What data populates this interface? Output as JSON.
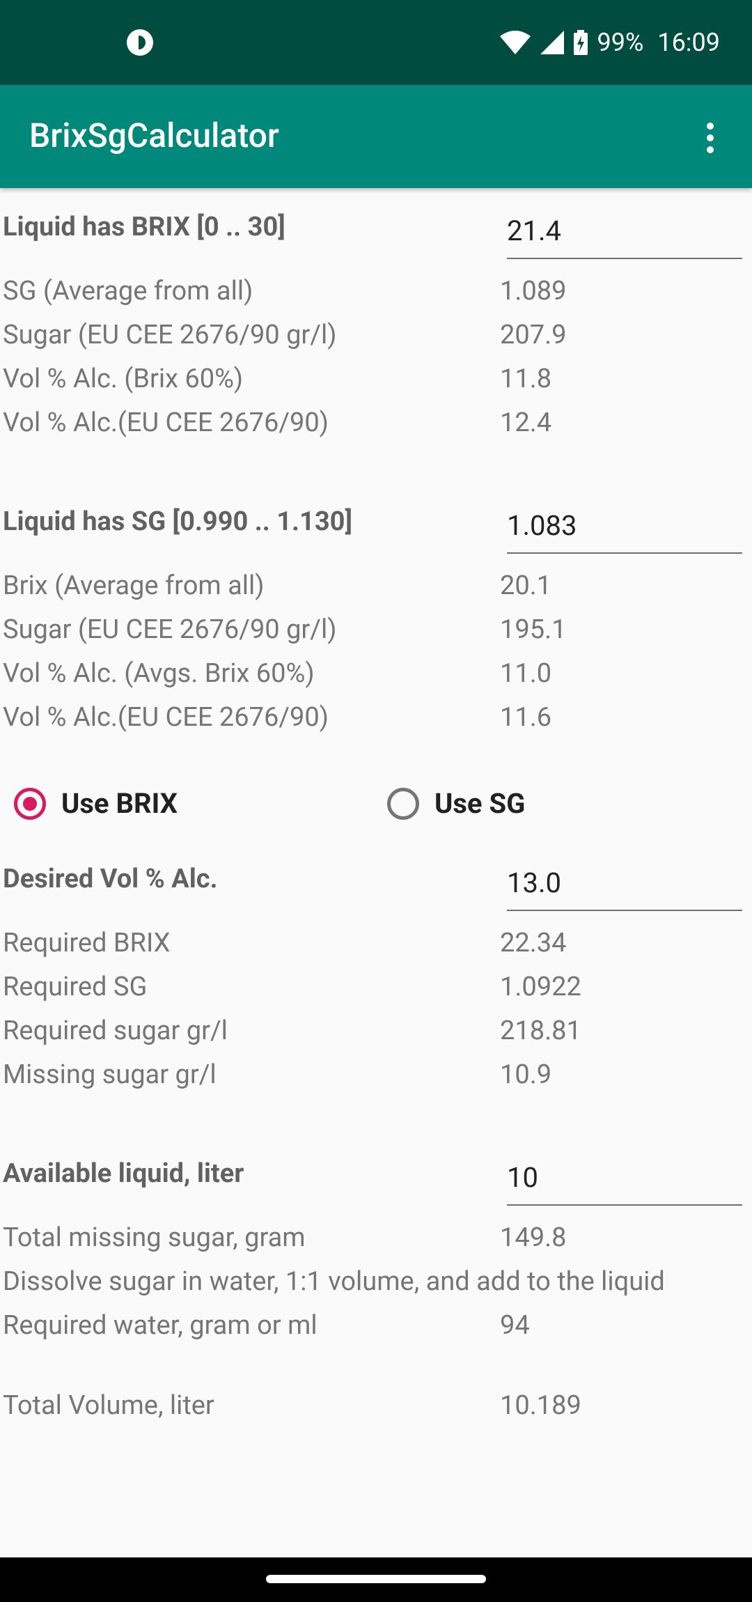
{
  "status": {
    "battery": "99%",
    "time": "16:09"
  },
  "appbar": {
    "title": "BrixSgCalculator"
  },
  "brix_section": {
    "input_label": "Liquid has BRIX [0 .. 30]",
    "input_value": "21.4",
    "rows": [
      {
        "label": "SG (Average from all)",
        "value": "1.089"
      },
      {
        "label": "Sugar (EU CEE 2676/90 gr/l)",
        "value": "207.9"
      },
      {
        "label": "Vol % Alc. (Brix 60%)",
        "value": "11.8"
      },
      {
        "label": "Vol % Alc.(EU CEE 2676/90)",
        "value": "12.4"
      }
    ]
  },
  "sg_section": {
    "input_label": "Liquid has SG [0.990 .. 1.130]",
    "input_value": "1.083",
    "rows": [
      {
        "label": "Brix (Average from all)",
        "value": "20.1"
      },
      {
        "label": "Sugar (EU CEE 2676/90 gr/l)",
        "value": "195.1"
      },
      {
        "label": "Vol % Alc. (Avgs. Brix 60%)",
        "value": "11.0"
      },
      {
        "label": "Vol % Alc.(EU CEE 2676/90)",
        "value": "11.6"
      }
    ]
  },
  "mode": {
    "use_brix_label": "Use BRIX",
    "use_sg_label": "Use SG",
    "selected": "Use BRIX"
  },
  "desired_section": {
    "input_label": "Desired Vol % Alc.",
    "input_value": "13.0",
    "rows": [
      {
        "label": "Required BRIX",
        "value": "22.34"
      },
      {
        "label": "Required SG",
        "value": "1.0922"
      },
      {
        "label": "Required sugar gr/l",
        "value": "218.81"
      },
      {
        "label": "Missing sugar gr/l",
        "value": "10.9"
      }
    ]
  },
  "liquid_section": {
    "input_label": "Available liquid, liter",
    "input_value": "10",
    "total_missing": {
      "label": "Total missing sugar, gram",
      "value": "149.8"
    },
    "instruction": "Dissolve sugar in water, 1:1 volume, and add to the liquid",
    "required_water": {
      "label": "Required water, gram or ml",
      "value": "94"
    },
    "total_volume": {
      "label": "Total Volume, liter",
      "value": "10.189"
    }
  }
}
